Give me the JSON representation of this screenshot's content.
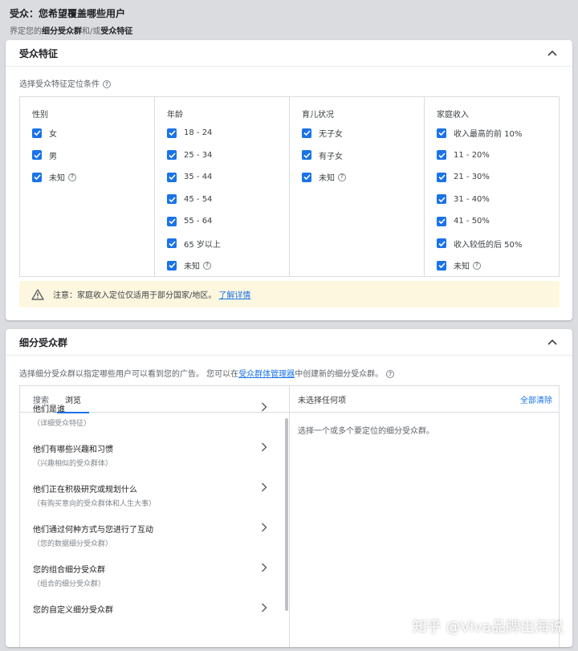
{
  "header": {
    "title": "受众：您希望覆盖哪些用户",
    "subtitle_prefix": "界定您的",
    "subtitle_bold1": "细分受众群",
    "subtitle_mid": "和/或",
    "subtitle_bold2": "受众特征"
  },
  "demographics": {
    "title": "受众特征",
    "label": "选择受众特征定位条件",
    "columns": [
      {
        "title": "性别",
        "items": [
          "女",
          "男",
          "未知"
        ]
      },
      {
        "title": "年龄",
        "items": [
          "18 - 24",
          "25 - 34",
          "35 - 44",
          "45 - 54",
          "55 - 64",
          "65 岁以上",
          "未知"
        ]
      },
      {
        "title": "育儿状况",
        "items": [
          "无子女",
          "有子女",
          "未知"
        ]
      },
      {
        "title": "家庭收入",
        "items": [
          "收入最高的前 10%",
          "11 - 20%",
          "21 - 30%",
          "31 - 40%",
          "41 - 50%",
          "收入较低的后 50%",
          "未知"
        ]
      }
    ],
    "notice_text": "注意：家庭收入定位仅适用于部分国家/地区。",
    "notice_link": "了解详情"
  },
  "segments": {
    "title": "细分受众群",
    "desc_prefix": "选择细分受众群以指定哪些用户可以看到您的广告。 您可以在",
    "desc_link": "受众群体管理器",
    "desc_suffix": "中创建新的细分受众群。",
    "tabs": [
      "搜索",
      "浏览"
    ],
    "active_tab": "浏览",
    "browse_items": [
      {
        "title": "他们是谁",
        "sub": "（详细受众特征）"
      },
      {
        "title": "他们有哪些兴趣和习惯",
        "sub": "（兴趣相似的受众群体）"
      },
      {
        "title": "他们正在积极研究或规划什么",
        "sub": "（有购买意向的受众群体和人生大事）"
      },
      {
        "title": "他们通过何种方式与您进行了互动",
        "sub": "（您的数据细分受众群）"
      },
      {
        "title": "您的组合细分受众群",
        "sub": "（组合的细分受众群）"
      },
      {
        "title": "您的自定义细分受众群",
        "sub": ""
      }
    ],
    "right_title": "未选择任何项",
    "clear_all": "全部清除",
    "right_empty": "选择一个或多个要定位的细分受众群。"
  },
  "watermark": "知乎 @Viva品牌出海说",
  "colors": {
    "accent": "#1a73e8",
    "notice_bg": "#fef7e0",
    "page_bg": "#dadce0"
  }
}
